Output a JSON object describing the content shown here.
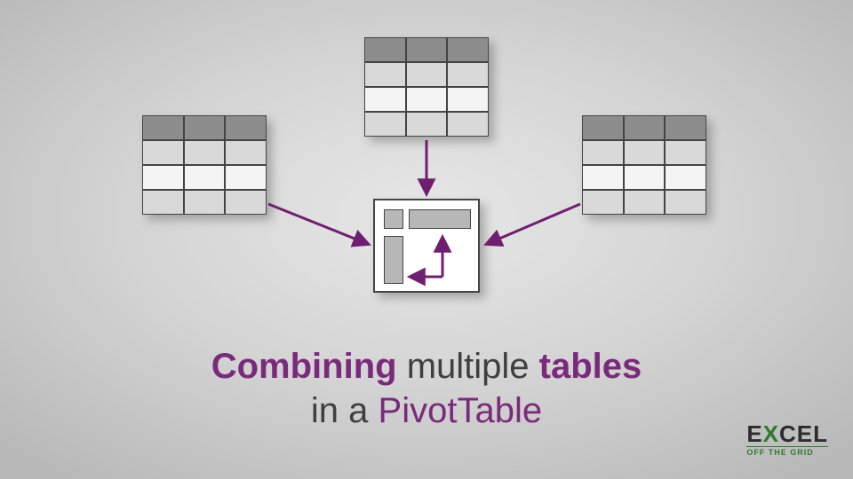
{
  "title": {
    "w1": "Combining",
    "w2": "multiple",
    "w3": "tables",
    "w4": "in a",
    "w5": "PivotTable"
  },
  "logo": {
    "pre": "E",
    "x": "X",
    "post": "CEL",
    "sub": "OFF THE GRID"
  },
  "colors": {
    "arrow": "#6f1f70",
    "accent": "#7a2a7a",
    "grid_dark": "#8d8d8d",
    "grid_light1": "#d9d9d9",
    "grid_light2": "#f4f4f4"
  },
  "diagram": {
    "source_tables": 3,
    "source_columns": 3,
    "source_rows": 3,
    "target": "pivot-table"
  }
}
